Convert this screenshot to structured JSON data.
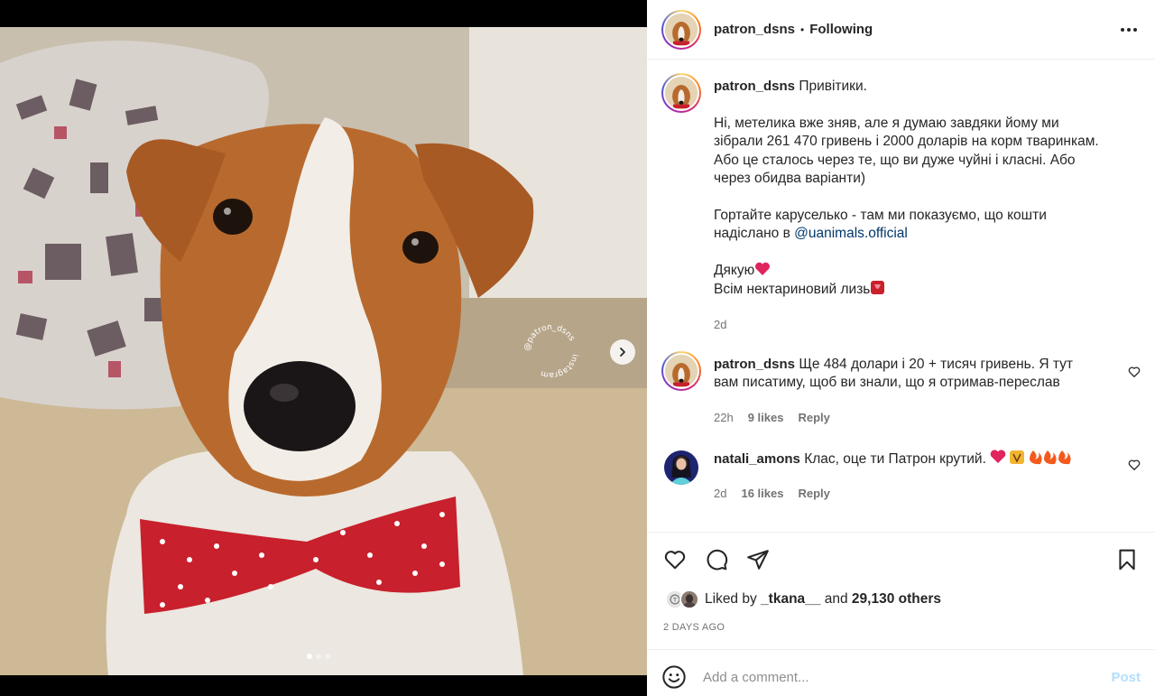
{
  "post": {
    "username": "patron_dsns",
    "separator": "•",
    "follow_status": "Following",
    "watermark_line1": "@patron_dsns",
    "watermark_line2": "instagram",
    "carousel": {
      "slide_count": 3,
      "active_index": 0
    }
  },
  "caption": {
    "username": "patron_dsns",
    "p1": "Привітики.",
    "p2": "Ні, метелика вже зняв, але я думаю завдяки йому ми зібрали 261 470 гривень і 2000 доларів на корм тваринкам. Або це сталось через те, що ви дуже чуйні і класні. Або через обидва варіанти)",
    "p3_text": "Гортайте каруселько - там ми показуємо, що кошти надіслано в",
    "p3_link": "@uanimals.official",
    "p4_line1": "Дякую",
    "p4_line2": "Всім нектариновий лизь",
    "time": "2d"
  },
  "comments": [
    {
      "username": "patron_dsns",
      "text": "Ще 484 долари і 20 + тисяч гривень. Я тут вам писатиму, щоб ви знали, що я отримав-переслав",
      "time": "22h",
      "likes": "9 likes",
      "reply": "Reply"
    },
    {
      "username": "natali_amons",
      "text": "Клас, оце ти Патрон крутий.",
      "time": "2d",
      "likes": "16 likes",
      "reply": "Reply"
    }
  ],
  "likes": {
    "prefix": "Liked by",
    "first_user": "_tkana__",
    "middle": "and",
    "others": "29,130 others"
  },
  "date": "2 DAYS AGO",
  "add_comment": {
    "placeholder": "Add a comment...",
    "post_label": "Post"
  },
  "colors": {
    "link": "#00376b",
    "post_button_disabled": "#b2dffc",
    "heart_red": "#e0245e",
    "muted": "#737373"
  }
}
